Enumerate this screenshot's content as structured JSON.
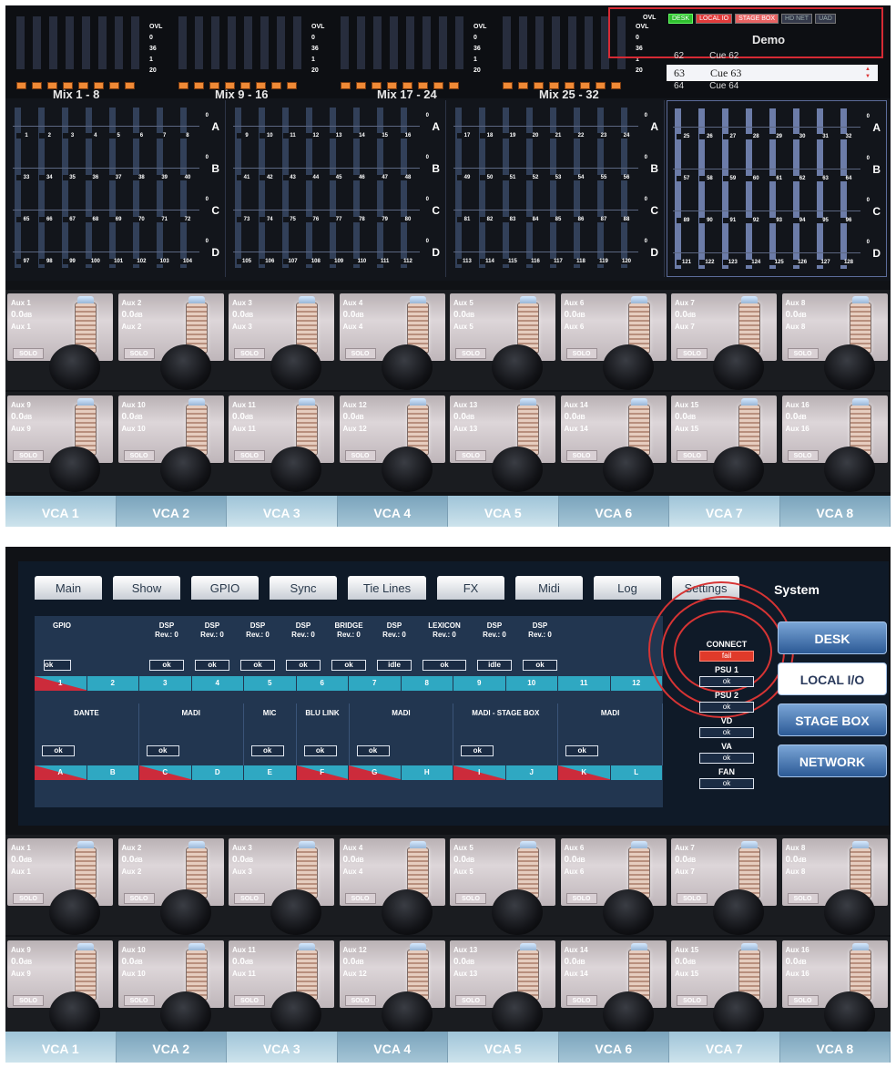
{
  "photo1": {
    "mix_banks": [
      {
        "label": "Mix 1 - 8"
      },
      {
        "label": "Mix 9 - 16"
      },
      {
        "label": "Mix 17 - 24"
      },
      {
        "label": "Mix 25 - 32"
      }
    ],
    "meter_scale": [
      "OVL",
      "0",
      "36",
      "1",
      "20"
    ],
    "status_flags": [
      "DESK",
      "LOCAL IO",
      "STAGE BOX",
      "HD NET",
      "UAD"
    ],
    "demo_title": "Demo",
    "cues": [
      {
        "num": "62",
        "name": "Cue 62",
        "selected": false
      },
      {
        "num": "63",
        "name": "Cue 63",
        "selected": true
      },
      {
        "num": "64",
        "name": "Cue 64",
        "selected": false
      }
    ],
    "channel_sections": [
      {
        "rows": [
          [
            "1",
            "2",
            "3",
            "4",
            "5",
            "6",
            "7",
            "8"
          ],
          [
            "33",
            "34",
            "35",
            "36",
            "37",
            "38",
            "39",
            "40"
          ],
          [
            "65",
            "66",
            "67",
            "68",
            "69",
            "70",
            "71",
            "72"
          ],
          [
            "97",
            "98",
            "99",
            "100",
            "101",
            "102",
            "103",
            "104"
          ]
        ]
      },
      {
        "rows": [
          [
            "9",
            "10",
            "11",
            "12",
            "13",
            "14",
            "15",
            "16"
          ],
          [
            "41",
            "42",
            "43",
            "44",
            "45",
            "46",
            "47",
            "48"
          ],
          [
            "73",
            "74",
            "75",
            "76",
            "77",
            "78",
            "79",
            "80"
          ],
          [
            "105",
            "106",
            "107",
            "108",
            "109",
            "110",
            "111",
            "112"
          ]
        ]
      },
      {
        "rows": [
          [
            "17",
            "18",
            "19",
            "20",
            "21",
            "22",
            "23",
            "24"
          ],
          [
            "49",
            "50",
            "51",
            "52",
            "53",
            "54",
            "55",
            "56"
          ],
          [
            "81",
            "82",
            "83",
            "84",
            "85",
            "86",
            "87",
            "88"
          ],
          [
            "113",
            "114",
            "115",
            "116",
            "117",
            "118",
            "119",
            "120"
          ]
        ]
      },
      {
        "rows": [
          [
            "25",
            "26",
            "27",
            "28",
            "29",
            "30",
            "31",
            "32"
          ],
          [
            "57",
            "58",
            "59",
            "60",
            "61",
            "62",
            "63",
            "64"
          ],
          [
            "89",
            "90",
            "91",
            "92",
            "93",
            "94",
            "95",
            "96"
          ],
          [
            "121",
            "122",
            "123",
            "124",
            "125",
            "126",
            "127",
            "128"
          ]
        ]
      }
    ],
    "row_letters": [
      "A",
      "B",
      "C",
      "D"
    ],
    "row_zero": "0"
  },
  "aux_rows": [
    [
      {
        "name": "Aux 1",
        "db": "0.0",
        "unit": "dB",
        "sub": "Aux 1"
      },
      {
        "name": "Aux 2",
        "db": "0.0",
        "unit": "dB",
        "sub": "Aux 2"
      },
      {
        "name": "Aux 3",
        "db": "0.0",
        "unit": "dB",
        "sub": "Aux 3"
      },
      {
        "name": "Aux 4",
        "db": "0.0",
        "unit": "dB",
        "sub": "Aux 4"
      },
      {
        "name": "Aux 5",
        "db": "0.0",
        "unit": "dB",
        "sub": "Aux 5"
      },
      {
        "name": "Aux 6",
        "db": "0.0",
        "unit": "dB",
        "sub": "Aux 6"
      },
      {
        "name": "Aux 7",
        "db": "0.0",
        "unit": "dB",
        "sub": "Aux 7"
      },
      {
        "name": "Aux 8",
        "db": "0.0",
        "unit": "dB",
        "sub": "Aux 8"
      }
    ],
    [
      {
        "name": "Aux 9",
        "db": "0.0",
        "unit": "dB",
        "sub": "Aux 9"
      },
      {
        "name": "Aux 10",
        "db": "0.0",
        "unit": "dB",
        "sub": "Aux 10"
      },
      {
        "name": "Aux 11",
        "db": "0.0",
        "unit": "dB",
        "sub": "Aux 11"
      },
      {
        "name": "Aux 12",
        "db": "0.0",
        "unit": "dB",
        "sub": "Aux 12"
      },
      {
        "name": "Aux 13",
        "db": "0.0",
        "unit": "dB",
        "sub": "Aux 13"
      },
      {
        "name": "Aux 14",
        "db": "0.0",
        "unit": "dB",
        "sub": "Aux 14"
      },
      {
        "name": "Aux 15",
        "db": "0.0",
        "unit": "dB",
        "sub": "Aux 15"
      },
      {
        "name": "Aux 16",
        "db": "0.0",
        "unit": "dB",
        "sub": "Aux 16"
      }
    ]
  ],
  "solo_label": "SOLO",
  "vcas": [
    "VCA 1",
    "VCA 2",
    "VCA 3",
    "VCA 4",
    "VCA 5",
    "VCA 6",
    "VCA 7",
    "VCA 8"
  ],
  "photo2": {
    "tabs": [
      "Main",
      "Show",
      "GPIO",
      "Sync",
      "Tie Lines",
      "FX",
      "Midi",
      "Log",
      "Settings"
    ],
    "active_tab": "System",
    "devices": [
      {
        "name": "GPIO",
        "rev": "",
        "status": "ok"
      },
      {
        "name": "DSP",
        "rev": "Rev.: 0",
        "status": "ok"
      },
      {
        "name": "DSP",
        "rev": "Rev.: 0",
        "status": "ok"
      },
      {
        "name": "DSP",
        "rev": "Rev.: 0",
        "status": "ok"
      },
      {
        "name": "DSP",
        "rev": "Rev.: 0",
        "status": "ok"
      },
      {
        "name": "BRIDGE",
        "rev": "Rev.: 0",
        "status": "ok"
      },
      {
        "name": "DSP",
        "rev": "Rev.: 0",
        "status": "idle"
      },
      {
        "name": "LEXICON",
        "rev": "Rev.: 0",
        "status": "ok"
      },
      {
        "name": "DSP",
        "rev": "Rev.: 0",
        "status": "idle"
      },
      {
        "name": "DSP",
        "rev": "Rev.: 0",
        "status": "ok"
      }
    ],
    "slots": [
      {
        "label": "1",
        "error": true
      },
      {
        "label": "2",
        "error": false
      },
      {
        "label": "3",
        "error": false
      },
      {
        "label": "4",
        "error": false
      },
      {
        "label": "5",
        "error": false
      },
      {
        "label": "6",
        "error": false
      },
      {
        "label": "7",
        "error": false
      },
      {
        "label": "8",
        "error": false
      },
      {
        "label": "9",
        "error": false
      },
      {
        "label": "10",
        "error": false
      },
      {
        "label": "11",
        "error": false
      },
      {
        "label": "12",
        "error": false
      }
    ],
    "cards": [
      {
        "name": "DANTE",
        "status": "ok",
        "span": 2
      },
      {
        "name": "MADI",
        "status": "ok",
        "span": 2
      },
      {
        "name": "MIC",
        "status": "ok",
        "span": 1
      },
      {
        "name": "BLU LINK",
        "status": "ok",
        "span": 1
      },
      {
        "name": "MADI",
        "status": "ok",
        "span": 2
      },
      {
        "name": "MADI - STAGE BOX",
        "status": "ok",
        "span": 2
      },
      {
        "name": "MADI",
        "status": "ok",
        "span": 2
      }
    ],
    "ports": [
      {
        "label": "A",
        "error": true
      },
      {
        "label": "B",
        "error": false
      },
      {
        "label": "C",
        "error": true
      },
      {
        "label": "D",
        "error": false
      },
      {
        "label": "E",
        "error": false
      },
      {
        "label": "F",
        "error": true
      },
      {
        "label": "G",
        "error": true
      },
      {
        "label": "H",
        "error": false
      },
      {
        "label": "I",
        "error": true
      },
      {
        "label": "J",
        "error": false
      },
      {
        "label": "K",
        "error": true
      },
      {
        "label": "L",
        "error": false
      }
    ],
    "health": [
      {
        "name": "CONNECT",
        "status": "fail"
      },
      {
        "name": "PSU 1",
        "status": "ok"
      },
      {
        "name": "PSU 2",
        "status": "ok"
      },
      {
        "name": "VD",
        "status": "ok"
      },
      {
        "name": "VA",
        "status": "ok"
      },
      {
        "name": "FAN",
        "status": "ok"
      }
    ],
    "side_buttons": [
      {
        "label": "DESK",
        "selected": false
      },
      {
        "label": "LOCAL I/O",
        "selected": true
      },
      {
        "label": "STAGE BOX",
        "selected": false
      },
      {
        "label": "NETWORK",
        "selected": false
      }
    ]
  }
}
